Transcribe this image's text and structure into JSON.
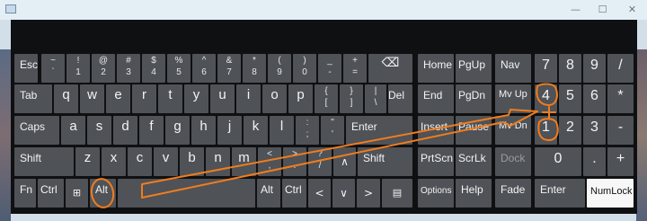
{
  "window": {
    "minimize": "—",
    "maximize": "☐",
    "close": "✕"
  },
  "row_function": {
    "esc": "Esc",
    "backtick": {
      "top": "~",
      "bottom": "`"
    },
    "d1": {
      "top": "!",
      "bottom": "1"
    },
    "d2": {
      "top": "@",
      "bottom": "2"
    },
    "d3": {
      "top": "#",
      "bottom": "3"
    },
    "d4": {
      "top": "$",
      "bottom": "4"
    },
    "d5": {
      "top": "%",
      "bottom": "5"
    },
    "d6": {
      "top": "^",
      "bottom": "6"
    },
    "d7": {
      "top": "&",
      "bottom": "7"
    },
    "d8": {
      "top": "*",
      "bottom": "8"
    },
    "d9": {
      "top": "(",
      "bottom": "9"
    },
    "d0": {
      "top": ")",
      "bottom": "0"
    },
    "minus": {
      "top": "_",
      "bottom": "-"
    },
    "equal": {
      "top": "+",
      "bottom": "="
    },
    "backspace": "⌫"
  },
  "row_tab": {
    "tab": "Tab",
    "letters": [
      "q",
      "w",
      "e",
      "r",
      "t",
      "y",
      "u",
      "i",
      "o",
      "p"
    ],
    "lbracket": {
      "top": "{",
      "bottom": "["
    },
    "rbracket": {
      "top": "}",
      "bottom": "]"
    },
    "backslash": {
      "top": "|",
      "bottom": "\\"
    },
    "del": "Del"
  },
  "row_caps": {
    "caps": "Caps",
    "letters": [
      "a",
      "s",
      "d",
      "f",
      "g",
      "h",
      "j",
      "k",
      "l"
    ],
    "semicolon": {
      "top": ":",
      "bottom": ";"
    },
    "quote": {
      "top": "\"",
      "bottom": "'"
    },
    "enter": "Enter"
  },
  "row_shift": {
    "shift_left": "Shift",
    "letters": [
      "z",
      "x",
      "c",
      "v",
      "b",
      "n",
      "m"
    ],
    "comma": {
      "top": "<",
      "bottom": ","
    },
    "period": {
      "top": ">",
      "bottom": "."
    },
    "slash": {
      "top": "?",
      "bottom": "/"
    },
    "up": "∧",
    "shift_right": "Shift"
  },
  "row_bottom": {
    "fn": "Fn",
    "ctrl_left": "Ctrl",
    "win": "⊞",
    "alt_left": "Alt",
    "alt_right": "Alt",
    "ctrl_right": "Ctrl",
    "left": "<",
    "down": "∨",
    "right": ">",
    "menu": "▤"
  },
  "nav": {
    "home": "Home",
    "pgup": "PgUp",
    "nav": "Nav",
    "end": "End",
    "pgdn": "PgDn",
    "mvup": "Mv Up",
    "insert": "Insert",
    "pause": "Pause",
    "mvdn": "Mv Dn",
    "prtscn": "PrtScn",
    "scrlk": "ScrLk",
    "dock": "Dock",
    "options": "Options",
    "help": "Help",
    "fade": "Fade"
  },
  "numpad": {
    "n7": "7",
    "n8": "8",
    "n9": "9",
    "div": "/",
    "n4": "4",
    "n5": "5",
    "n6": "6",
    "mul": "*",
    "n1": "1",
    "n2": "2",
    "n3": "3",
    "sub": "-",
    "n0": "0",
    "dot": ".",
    "add": "+",
    "enter": "Enter",
    "numlock": "NumLock"
  },
  "colors": {
    "key": "#4f5257",
    "board": "#0f1012",
    "annotation": "#f07d1e",
    "numlock_active": "#f7f7f7"
  }
}
